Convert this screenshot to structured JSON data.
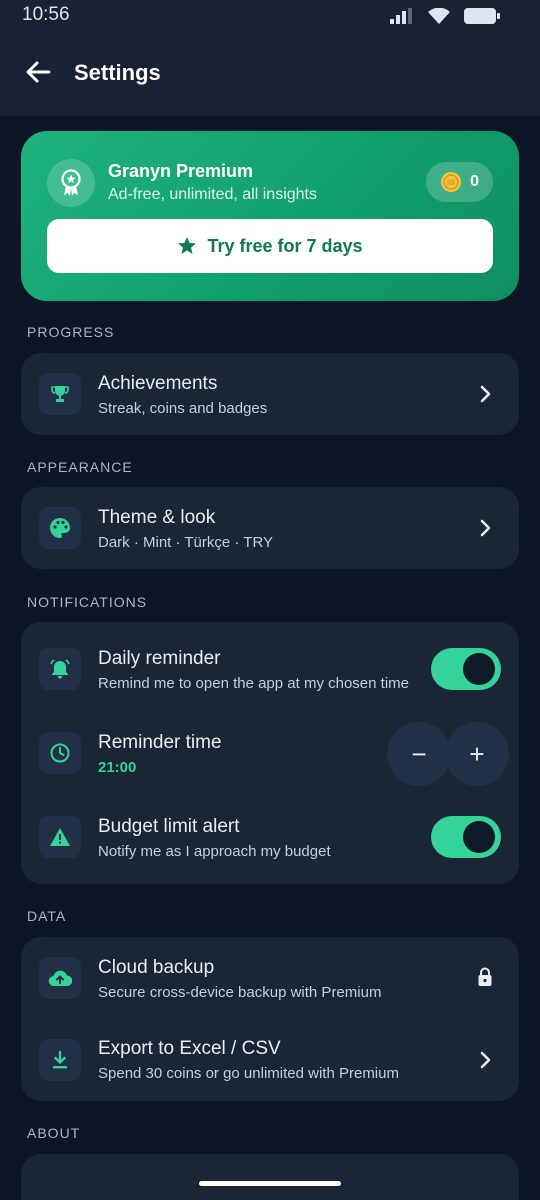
{
  "status_bar": {
    "time": "10:56"
  },
  "app_bar": {
    "title": "Settings"
  },
  "premium": {
    "title": "Granyn Premium",
    "subtitle": "Ad-free, unlimited, all insights",
    "coins": "0",
    "cta_label": "Try free for 7 days"
  },
  "sections": {
    "progress": "PROGRESS",
    "appearance": "APPEARANCE",
    "notifications": "NOTIFICATIONS",
    "data": "DATA",
    "about": "ABOUT"
  },
  "progress": {
    "achievements": {
      "title": "Achievements",
      "subtitle": "Streak, coins and badges"
    }
  },
  "appearance": {
    "theme": {
      "title": "Theme & look",
      "subtitle": "Dark · Mint · Türkçe · TRY"
    }
  },
  "notifications": {
    "daily_reminder": {
      "title": "Daily reminder",
      "subtitle": "Remind me to open the app at my chosen time",
      "enabled": true
    },
    "reminder_time": {
      "title": "Reminder time",
      "value": "21:00",
      "decrement": "−",
      "increment": "+"
    },
    "budget_alert": {
      "title": "Budget limit alert",
      "subtitle": "Notify me as I approach my budget",
      "enabled": true
    }
  },
  "data": {
    "cloud_backup": {
      "title": "Cloud backup",
      "subtitle": "Secure cross-device backup with Premium"
    },
    "export": {
      "title": "Export to Excel / CSV",
      "subtitle": "Spend 30 coins or go unlimited with Premium"
    }
  },
  "colors": {
    "accent": "#34d399",
    "background": "#0d1626",
    "card": "#1a2536",
    "premium_gradient_start": "#1fb27e"
  },
  "icons": {
    "premium": "award-badge-icon",
    "coin": "coin-icon",
    "achievements": "trophy-icon",
    "theme": "palette-icon",
    "daily_reminder": "bell-icon",
    "reminder_time": "clock-icon",
    "budget_alert": "warning-icon",
    "cloud_backup": "cloud-upload-icon",
    "export": "download-icon",
    "lock": "lock-icon"
  }
}
